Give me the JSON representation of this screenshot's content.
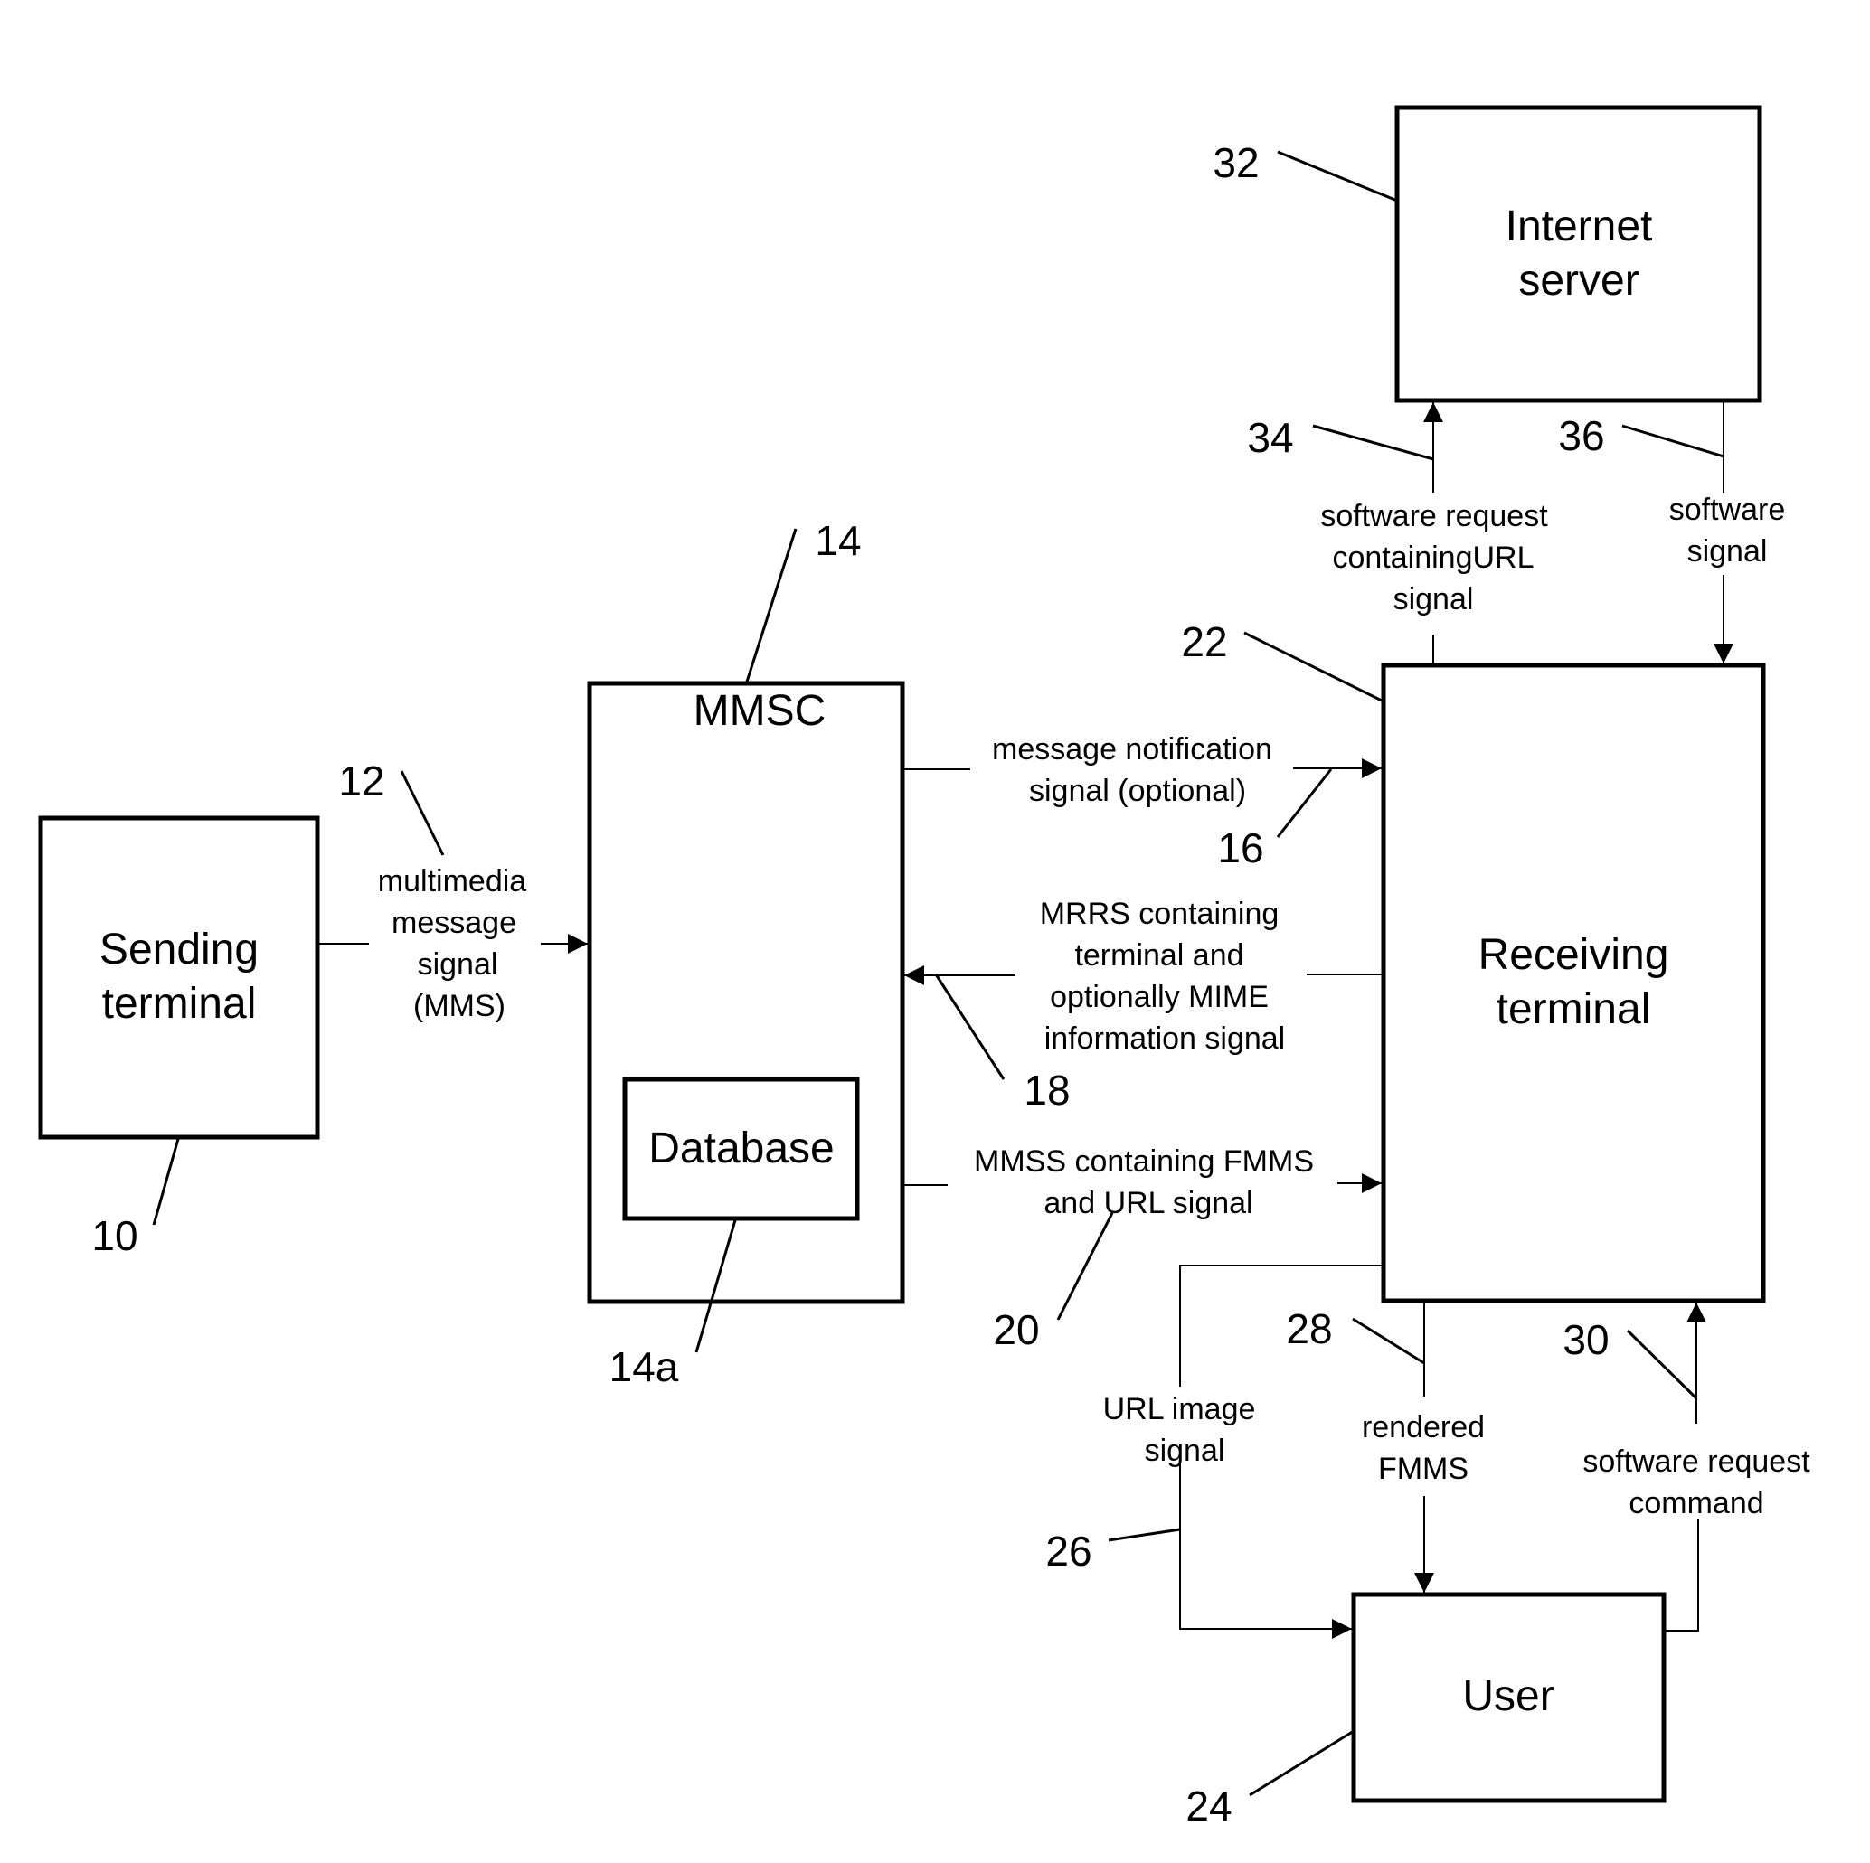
{
  "diagram": {
    "blocks": {
      "sending_terminal": {
        "ref": "10",
        "lines": [
          "Sending",
          "terminal"
        ]
      },
      "mmsc": {
        "ref": "14",
        "lines": [
          "MMSC"
        ]
      },
      "database": {
        "ref": "14a",
        "lines": [
          "Database"
        ]
      },
      "receiving_terminal": {
        "ref": "22",
        "lines": [
          "Receiving",
          "terminal"
        ]
      },
      "internet_server": {
        "ref": "32",
        "lines": [
          "Internet",
          "server"
        ]
      },
      "user": {
        "ref": "24",
        "lines": [
          "User"
        ]
      }
    },
    "signals": {
      "mms": {
        "ref": "12",
        "lines": [
          "multimedia",
          "message",
          "signal",
          "(MMS)"
        ]
      },
      "notification": {
        "ref": "16",
        "lines": [
          "message notification",
          "signal (optional)"
        ]
      },
      "mrrs": {
        "ref": "18",
        "lines": [
          "MRRS containing",
          "terminal and",
          "optionally MIME",
          "information signal"
        ]
      },
      "mmss": {
        "ref": "20",
        "lines": [
          "MMSS containing FMMS",
          "and URL signal"
        ]
      },
      "url_image": {
        "ref": "26",
        "lines": [
          "URL image",
          "signal"
        ]
      },
      "rendered_fmms": {
        "ref": "28",
        "lines": [
          "rendered",
          "FMMS"
        ]
      },
      "sw_request_command": {
        "ref": "30",
        "lines": [
          "software request",
          "command"
        ]
      },
      "sw_request_url": {
        "ref": "34",
        "lines": [
          "software request",
          "containingURL",
          "signal"
        ]
      },
      "software_signal": {
        "ref": "36",
        "lines": [
          "software",
          "signal"
        ]
      }
    }
  }
}
